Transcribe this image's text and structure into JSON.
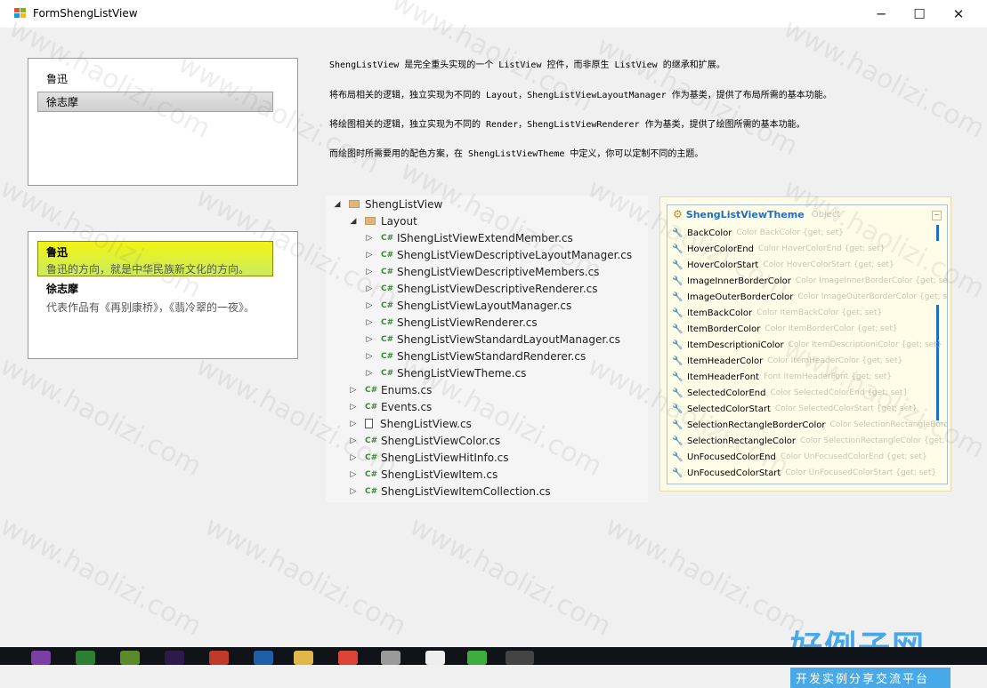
{
  "window": {
    "title": "FormShengListView"
  },
  "listbox1": {
    "items": [
      "鲁迅",
      "徐志摩"
    ]
  },
  "listbox2": {
    "items": [
      {
        "header": "鲁迅",
        "desc": "鲁迅的方向，就是中华民族新文化的方向。"
      },
      {
        "header": "徐志摩",
        "desc": "代表作品有《再别康桥》，《翡冷翠的一夜》。"
      }
    ]
  },
  "paragraphs": [
    "ShengListView 是完全重头实现的一个 ListView 控件，而非原生 ListView 的继承和扩展。",
    "将布局相关的逻辑，独立实现为不同的 Layout，ShengListViewLayoutManager 作为基类，提供了布局所需的基本功能。",
    "将绘图相关的逻辑，独立实现为不同的 Render，ShengListViewRenderer 作为基类，提供了绘图所需的基本功能。",
    "而绘图时所需要用的配色方案，在 ShengListViewTheme 中定义，你可以定制不同的主题。"
  ],
  "tree": {
    "root": "ShengListView",
    "layout_folder": "Layout",
    "layout_files": [
      "IShengListViewExtendMember.cs",
      "ShengListViewDescriptiveLayoutManager.cs",
      "ShengListViewDescriptiveMembers.cs",
      "ShengListViewDescriptiveRenderer.cs",
      "ShengListViewLayoutManager.cs",
      "ShengListViewRenderer.cs",
      "ShengListViewStandardLayoutManager.cs",
      "ShengListViewStandardRenderer.cs",
      "ShengListViewTheme.cs"
    ],
    "root_files": [
      "Enums.cs",
      "Events.cs",
      "ShengListView.cs",
      "ShengListViewColor.cs",
      "ShengListViewHitInfo.cs",
      "ShengListViewItem.cs",
      "ShengListViewItemCollection.cs"
    ],
    "cs_label": "C#"
  },
  "class_panel": {
    "name": "ShengListViewTheme",
    "kind": "Object",
    "properties": [
      {
        "name": "BackColor",
        "sig": "Color BackColor {get; set}"
      },
      {
        "name": "HoverColorEnd",
        "sig": "Color HoverColorEnd {get; set}"
      },
      {
        "name": "HoverColorStart",
        "sig": "Color HoverColorStart {get; set}"
      },
      {
        "name": "ImageInnerBorderColor",
        "sig": "Color ImageInnerBorderColor {get; set}"
      },
      {
        "name": "ImageOuterBorderColor",
        "sig": "Color ImageOuterBorderColor {get; set}"
      },
      {
        "name": "ItemBackColor",
        "sig": "Color ItemBackColor {get; set}"
      },
      {
        "name": "ItemBorderColor",
        "sig": "Color ItemBorderColor {get; set}"
      },
      {
        "name": "ItemDescriptioniColor",
        "sig": "Color ItemDescriptioniColor {get; set}"
      },
      {
        "name": "ItemHeaderColor",
        "sig": "Color ItemHeaderColor {get; set}"
      },
      {
        "name": "ItemHeaderFont",
        "sig": "Font ItemHeaderFont {get; set}"
      },
      {
        "name": "SelectedColorEnd",
        "sig": "Color SelectedColorEnd {get; set}"
      },
      {
        "name": "SelectedColorStart",
        "sig": "Color SelectedColorStart {get; set}"
      },
      {
        "name": "SelectionRectangleBorderColor",
        "sig": "Color SelectionRectangleBorderColor"
      },
      {
        "name": "SelectionRectangleColor",
        "sig": "Color SelectionRectangleColor {get; set}"
      },
      {
        "name": "UnFocusedColorEnd",
        "sig": "Color UnFocusedColorEnd {get; set}"
      },
      {
        "name": "UnFocusedColorStart",
        "sig": "Color UnFocusedColorStart {get; set}"
      }
    ]
  },
  "watermark": {
    "text": "www.haolizi.com",
    "logo_big": "好例子网",
    "logo_small": "开发实例分享交流平台"
  },
  "colors": {
    "highlight_top": "#f4f411",
    "highlight_bottom": "#c9ec62",
    "accent": "#1c6fc9",
    "cs_green": "#388a34"
  }
}
